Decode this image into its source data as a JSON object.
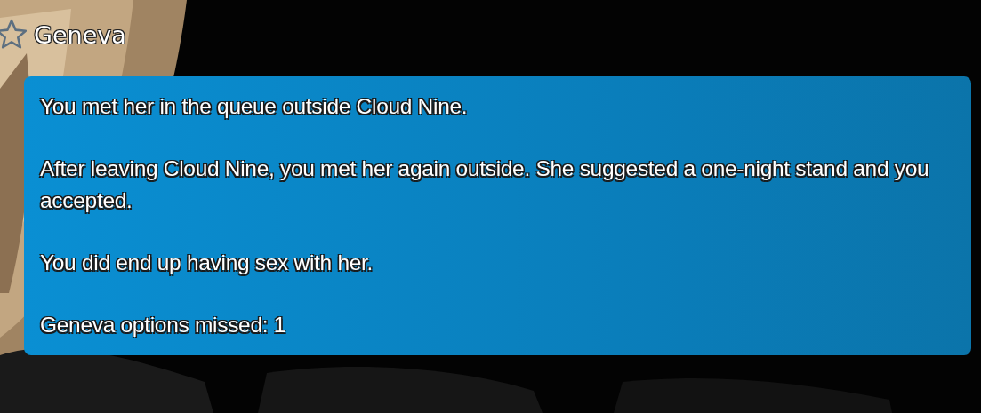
{
  "character": {
    "name": "Geneva",
    "starred": false
  },
  "notes": [
    "You met her in the queue outside Cloud Nine.",
    "After leaving Cloud Nine, you met her again outside. She suggested a one-night stand and you accepted.",
    "You did end up having sex with her.",
    "Geneva options missed: 1"
  ]
}
